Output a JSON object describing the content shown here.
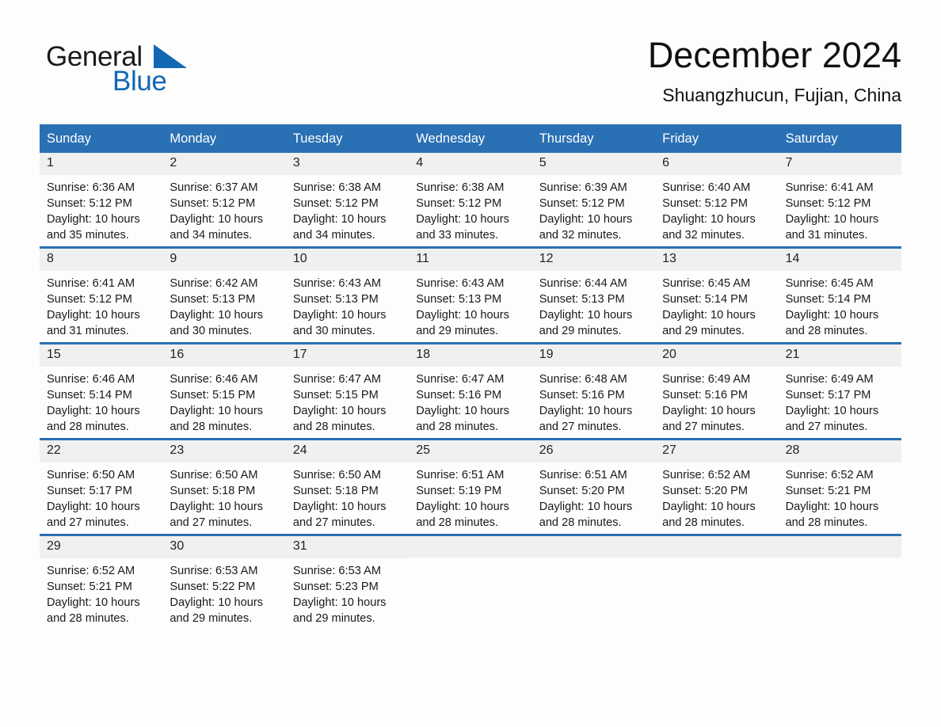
{
  "brand": {
    "name_top": "General",
    "name_bottom": "Blue",
    "accent_color": "#1268b3"
  },
  "header": {
    "title": "December 2024",
    "location": "Shuangzhucun, Fujian, China"
  },
  "theme": {
    "header_blue": "#2a70b4",
    "daynum_band": "#f0f0f0",
    "page_background": "#fdfdfd",
    "text": "#1a1a1a"
  },
  "calendar": {
    "weekday_headers": [
      "Sunday",
      "Monday",
      "Tuesday",
      "Wednesday",
      "Thursday",
      "Friday",
      "Saturday"
    ],
    "weeks": [
      [
        {
          "day": "1",
          "sunrise": "Sunrise: 6:36 AM",
          "sunset": "Sunset: 5:12 PM",
          "daylight": "Daylight: 10 hours and 35 minutes."
        },
        {
          "day": "2",
          "sunrise": "Sunrise: 6:37 AM",
          "sunset": "Sunset: 5:12 PM",
          "daylight": "Daylight: 10 hours and 34 minutes."
        },
        {
          "day": "3",
          "sunrise": "Sunrise: 6:38 AM",
          "sunset": "Sunset: 5:12 PM",
          "daylight": "Daylight: 10 hours and 34 minutes."
        },
        {
          "day": "4",
          "sunrise": "Sunrise: 6:38 AM",
          "sunset": "Sunset: 5:12 PM",
          "daylight": "Daylight: 10 hours and 33 minutes."
        },
        {
          "day": "5",
          "sunrise": "Sunrise: 6:39 AM",
          "sunset": "Sunset: 5:12 PM",
          "daylight": "Daylight: 10 hours and 32 minutes."
        },
        {
          "day": "6",
          "sunrise": "Sunrise: 6:40 AM",
          "sunset": "Sunset: 5:12 PM",
          "daylight": "Daylight: 10 hours and 32 minutes."
        },
        {
          "day": "7",
          "sunrise": "Sunrise: 6:41 AM",
          "sunset": "Sunset: 5:12 PM",
          "daylight": "Daylight: 10 hours and 31 minutes."
        }
      ],
      [
        {
          "day": "8",
          "sunrise": "Sunrise: 6:41 AM",
          "sunset": "Sunset: 5:12 PM",
          "daylight": "Daylight: 10 hours and 31 minutes."
        },
        {
          "day": "9",
          "sunrise": "Sunrise: 6:42 AM",
          "sunset": "Sunset: 5:13 PM",
          "daylight": "Daylight: 10 hours and 30 minutes."
        },
        {
          "day": "10",
          "sunrise": "Sunrise: 6:43 AM",
          "sunset": "Sunset: 5:13 PM",
          "daylight": "Daylight: 10 hours and 30 minutes."
        },
        {
          "day": "11",
          "sunrise": "Sunrise: 6:43 AM",
          "sunset": "Sunset: 5:13 PM",
          "daylight": "Daylight: 10 hours and 29 minutes."
        },
        {
          "day": "12",
          "sunrise": "Sunrise: 6:44 AM",
          "sunset": "Sunset: 5:13 PM",
          "daylight": "Daylight: 10 hours and 29 minutes."
        },
        {
          "day": "13",
          "sunrise": "Sunrise: 6:45 AM",
          "sunset": "Sunset: 5:14 PM",
          "daylight": "Daylight: 10 hours and 29 minutes."
        },
        {
          "day": "14",
          "sunrise": "Sunrise: 6:45 AM",
          "sunset": "Sunset: 5:14 PM",
          "daylight": "Daylight: 10 hours and 28 minutes."
        }
      ],
      [
        {
          "day": "15",
          "sunrise": "Sunrise: 6:46 AM",
          "sunset": "Sunset: 5:14 PM",
          "daylight": "Daylight: 10 hours and 28 minutes."
        },
        {
          "day": "16",
          "sunrise": "Sunrise: 6:46 AM",
          "sunset": "Sunset: 5:15 PM",
          "daylight": "Daylight: 10 hours and 28 minutes."
        },
        {
          "day": "17",
          "sunrise": "Sunrise: 6:47 AM",
          "sunset": "Sunset: 5:15 PM",
          "daylight": "Daylight: 10 hours and 28 minutes."
        },
        {
          "day": "18",
          "sunrise": "Sunrise: 6:47 AM",
          "sunset": "Sunset: 5:16 PM",
          "daylight": "Daylight: 10 hours and 28 minutes."
        },
        {
          "day": "19",
          "sunrise": "Sunrise: 6:48 AM",
          "sunset": "Sunset: 5:16 PM",
          "daylight": "Daylight: 10 hours and 27 minutes."
        },
        {
          "day": "20",
          "sunrise": "Sunrise: 6:49 AM",
          "sunset": "Sunset: 5:16 PM",
          "daylight": "Daylight: 10 hours and 27 minutes."
        },
        {
          "day": "21",
          "sunrise": "Sunrise: 6:49 AM",
          "sunset": "Sunset: 5:17 PM",
          "daylight": "Daylight: 10 hours and 27 minutes."
        }
      ],
      [
        {
          "day": "22",
          "sunrise": "Sunrise: 6:50 AM",
          "sunset": "Sunset: 5:17 PM",
          "daylight": "Daylight: 10 hours and 27 minutes."
        },
        {
          "day": "23",
          "sunrise": "Sunrise: 6:50 AM",
          "sunset": "Sunset: 5:18 PM",
          "daylight": "Daylight: 10 hours and 27 minutes."
        },
        {
          "day": "24",
          "sunrise": "Sunrise: 6:50 AM",
          "sunset": "Sunset: 5:18 PM",
          "daylight": "Daylight: 10 hours and 27 minutes."
        },
        {
          "day": "25",
          "sunrise": "Sunrise: 6:51 AM",
          "sunset": "Sunset: 5:19 PM",
          "daylight": "Daylight: 10 hours and 28 minutes."
        },
        {
          "day": "26",
          "sunrise": "Sunrise: 6:51 AM",
          "sunset": "Sunset: 5:20 PM",
          "daylight": "Daylight: 10 hours and 28 minutes."
        },
        {
          "day": "27",
          "sunrise": "Sunrise: 6:52 AM",
          "sunset": "Sunset: 5:20 PM",
          "daylight": "Daylight: 10 hours and 28 minutes."
        },
        {
          "day": "28",
          "sunrise": "Sunrise: 6:52 AM",
          "sunset": "Sunset: 5:21 PM",
          "daylight": "Daylight: 10 hours and 28 minutes."
        }
      ],
      [
        {
          "day": "29",
          "sunrise": "Sunrise: 6:52 AM",
          "sunset": "Sunset: 5:21 PM",
          "daylight": "Daylight: 10 hours and 28 minutes."
        },
        {
          "day": "30",
          "sunrise": "Sunrise: 6:53 AM",
          "sunset": "Sunset: 5:22 PM",
          "daylight": "Daylight: 10 hours and 29 minutes."
        },
        {
          "day": "31",
          "sunrise": "Sunrise: 6:53 AM",
          "sunset": "Sunset: 5:23 PM",
          "daylight": "Daylight: 10 hours and 29 minutes."
        },
        {
          "day": "",
          "sunrise": "",
          "sunset": "",
          "daylight": ""
        },
        {
          "day": "",
          "sunrise": "",
          "sunset": "",
          "daylight": ""
        },
        {
          "day": "",
          "sunrise": "",
          "sunset": "",
          "daylight": ""
        },
        {
          "day": "",
          "sunrise": "",
          "sunset": "",
          "daylight": ""
        }
      ]
    ]
  }
}
